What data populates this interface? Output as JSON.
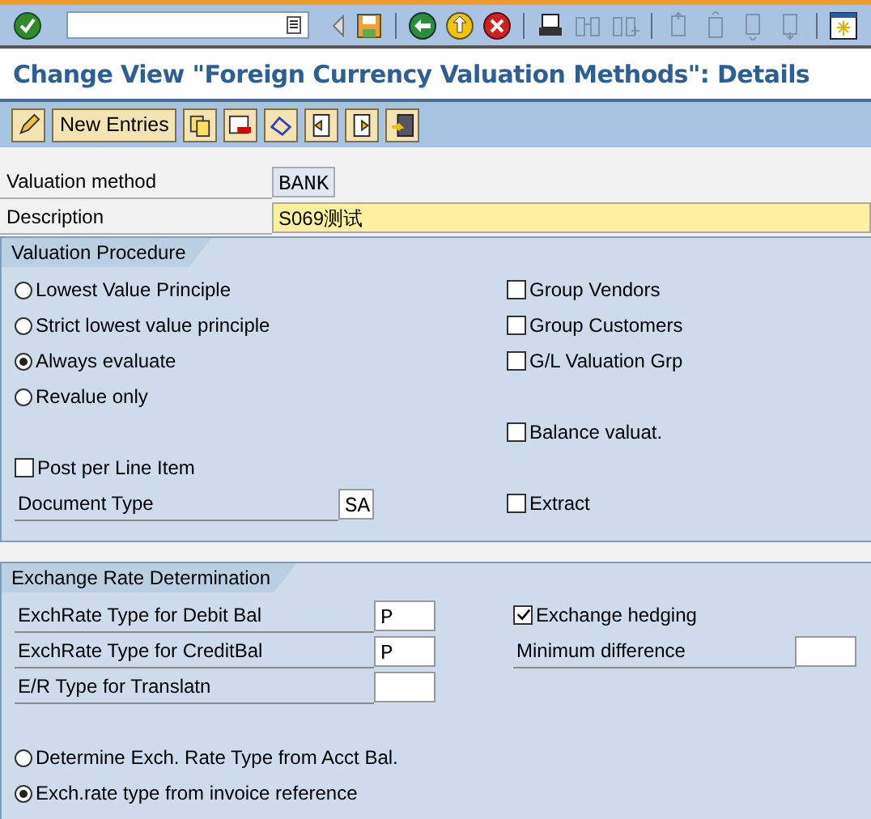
{
  "title": "Change View \"Foreign Currency Valuation Methods\": Details",
  "app_toolbar": {
    "new_entries": "New Entries"
  },
  "header_fields": [
    {
      "label": "Valuation method",
      "value": "BANK",
      "kind": "key"
    },
    {
      "label": "Description",
      "value": "S069测试",
      "kind": "text"
    }
  ],
  "valuation_procedure": {
    "title": "Valuation Procedure",
    "radios": [
      {
        "label": "Lowest Value Principle",
        "selected": false
      },
      {
        "label": "Strict lowest value principle",
        "selected": false
      },
      {
        "label": "Always evaluate",
        "selected": true
      },
      {
        "label": "Revalue only",
        "selected": false
      }
    ],
    "checkboxes": [
      {
        "label": "Group Vendors",
        "checked": false
      },
      {
        "label": "Group Customers",
        "checked": false
      },
      {
        "label": "G/L Valuation Grp",
        "checked": false
      },
      {
        "label": "Balance valuat.",
        "checked": false
      },
      {
        "label": "Extract",
        "checked": false
      }
    ],
    "post_per_line_item": {
      "label": "Post per Line Item",
      "checked": false
    },
    "document_type": {
      "label": "Document Type",
      "value": "SA"
    }
  },
  "exchange_rate_determination": {
    "title": "Exchange Rate Determination",
    "fields": [
      {
        "label": "ExchRate Type for Debit Bal",
        "value": "P"
      },
      {
        "label": "ExchRate Type for CreditBal",
        "value": "P"
      },
      {
        "label": "E/R Type for Translatn"
      }
    ],
    "exchange_hedging": {
      "label": "Exchange hedging",
      "checked": true
    },
    "minimum_difference": {
      "label": "Minimum difference"
    },
    "radios": [
      {
        "label": "Determine Exch. Rate Type from Acct Bal.",
        "selected": false
      },
      {
        "label": "Exch.rate type from invoice reference",
        "selected": true
      }
    ]
  }
}
